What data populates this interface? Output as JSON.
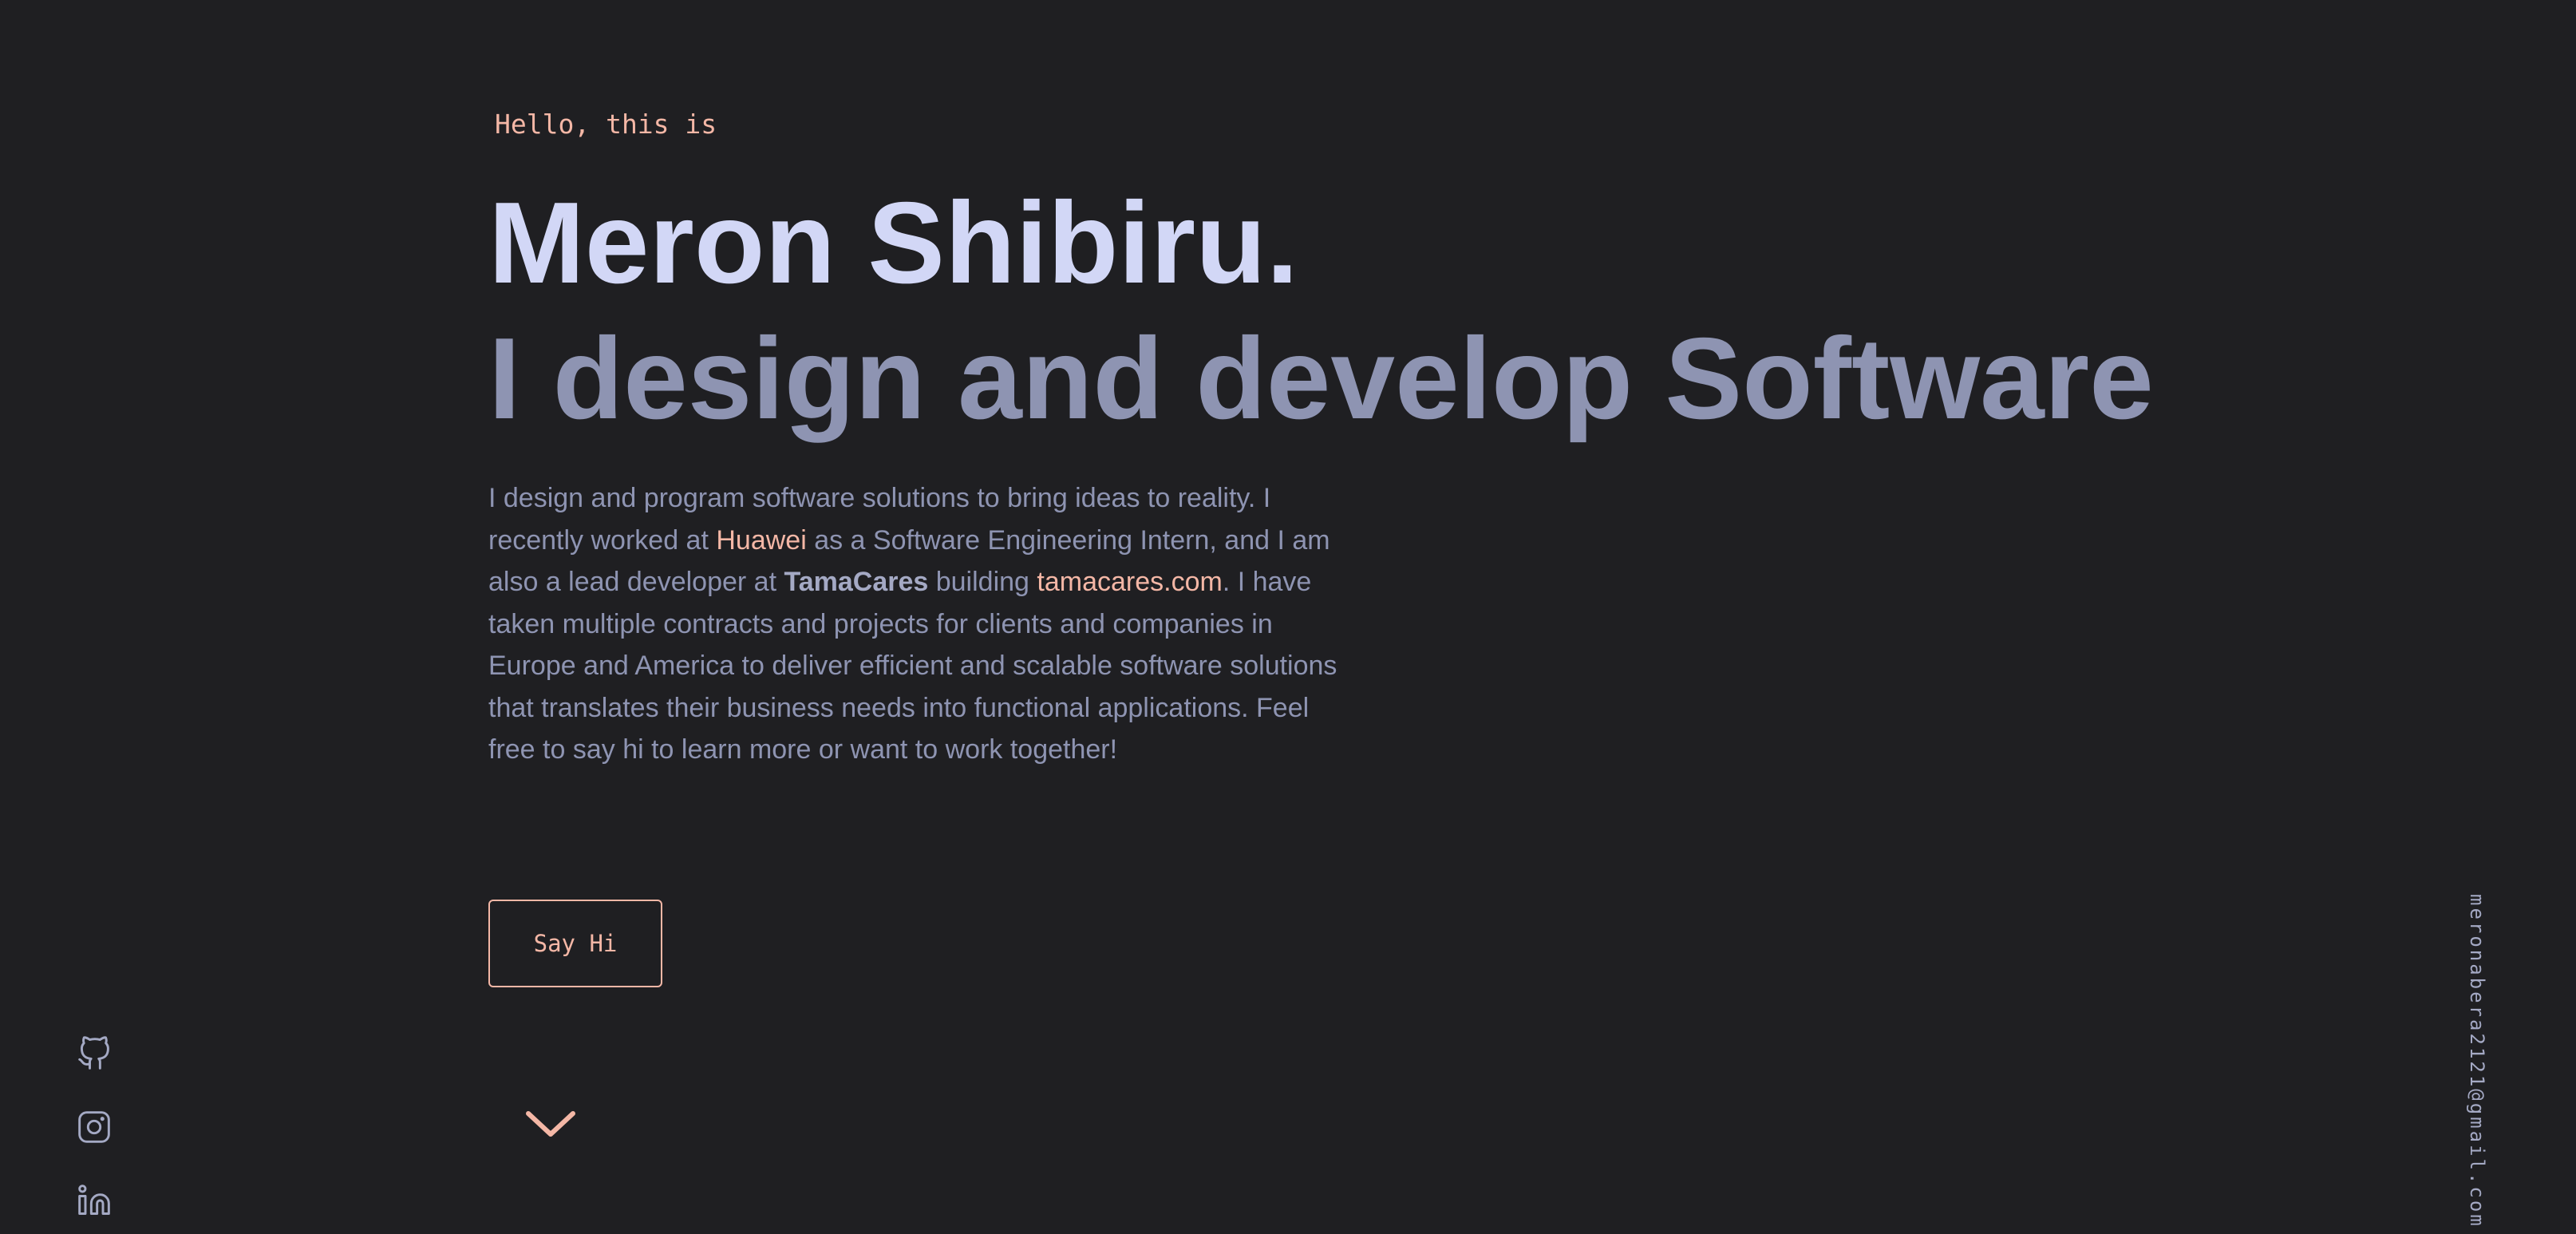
{
  "colors": {
    "background": "#1f1f22",
    "accent": "#f4b7a6",
    "name": "#d2d7f6",
    "muted": "#8e94b2"
  },
  "hero": {
    "greeting": "Hello, this is",
    "name": "Meron Shibiru.",
    "tagline": "I design and develop Software",
    "bio": {
      "part1": "I design and program software solutions to bring ideas to reality. I recently worked at ",
      "company": "Huawei",
      "part2": " as a Software Engineering Intern, and I am also a lead developer at ",
      "org": "TamaCares",
      "part3": " building ",
      "site": "tamacares.com",
      "part4": ". I have taken multiple contracts and projects for clients and companies in Europe and America to deliver efficient and scalable software solutions that translates their business needs into functional applications. Feel free to say hi to learn more or want to work together!"
    },
    "cta_label": "Say Hi",
    "scroll_icon": "chevron-down-icon"
  },
  "socials": [
    {
      "name": "GitHub",
      "icon": "github-icon"
    },
    {
      "name": "Instagram",
      "icon": "instagram-icon"
    },
    {
      "name": "LinkedIn",
      "icon": "linkedin-icon"
    }
  ],
  "email": "meronabera2121@gmail.com"
}
